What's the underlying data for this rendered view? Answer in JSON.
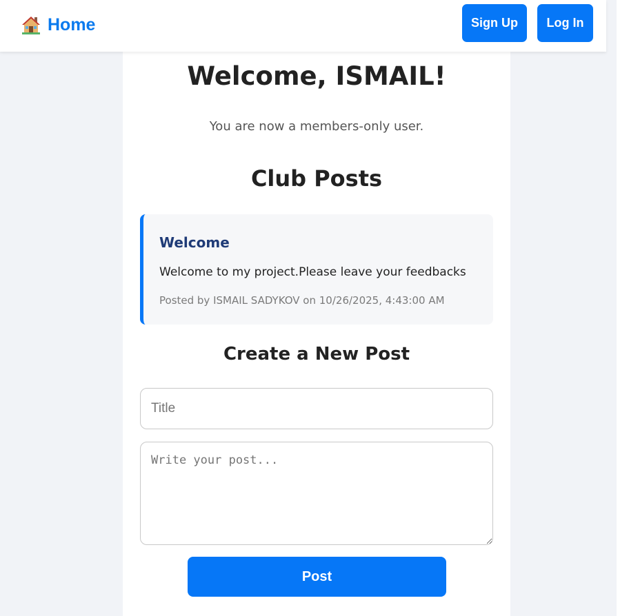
{
  "nav": {
    "home_label": "Home",
    "home_icon": "house-icon",
    "signup_label": "Sign Up",
    "login_label": "Log In"
  },
  "main": {
    "welcome_title": "Welcome, ISMAIL!",
    "member_status": "You are now a members-only user.",
    "posts_heading": "Club Posts",
    "posts": [
      {
        "title": "Welcome",
        "body": "Welcome to my project.Please leave your feedbacks",
        "meta": "Posted by ISMAIL SADYKOV on 10/26/2025, 4:43:00 AM"
      }
    ],
    "create_heading": "Create a New Post"
  },
  "form": {
    "title_placeholder": "Title",
    "title_value": "",
    "body_placeholder": "Write your post...",
    "body_value": "",
    "submit_label": "Post"
  },
  "colors": {
    "accent": "#0677f7",
    "post_title": "#1f3b77",
    "page_bg": "#f1f3f7"
  }
}
